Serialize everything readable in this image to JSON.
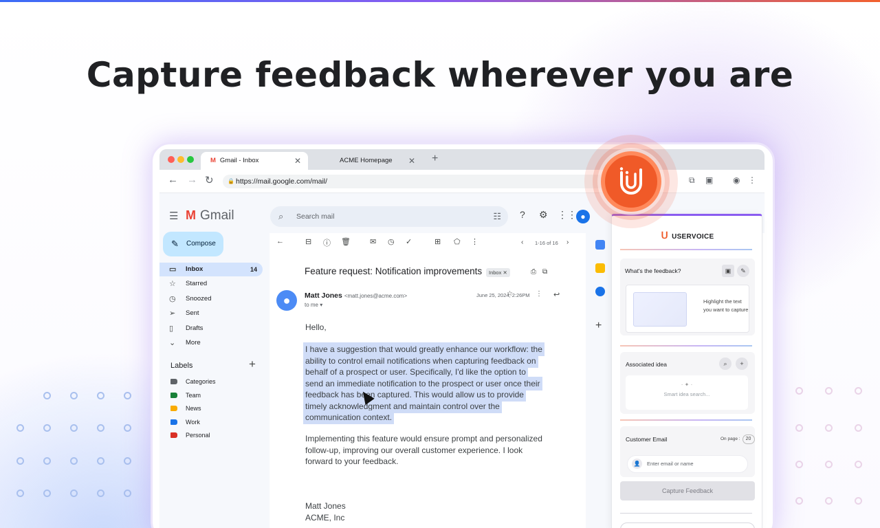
{
  "headline": "Capture feedback wherever you are",
  "browser": {
    "tabs": [
      {
        "label": "Gmail - Inbox",
        "icon": "gmail-icon",
        "active": true
      },
      {
        "label": "ACME Homepage",
        "icon": "none",
        "active": false
      }
    ],
    "new_tab": "+",
    "url": "https://mail.google.com/mail/"
  },
  "gmail": {
    "app_name": "Gmail",
    "search_placeholder": "Search mail",
    "compose_label": "Compose",
    "nav": [
      {
        "label": "Inbox",
        "count": "14",
        "icon": "inbox-icon"
      },
      {
        "label": "Starred",
        "count": "",
        "icon": "star-icon"
      },
      {
        "label": "Snoozed",
        "count": "",
        "icon": "clock-icon"
      },
      {
        "label": "Sent",
        "count": "",
        "icon": "send-icon"
      },
      {
        "label": "Drafts",
        "count": "",
        "icon": "draft-icon"
      },
      {
        "label": "More",
        "count": "",
        "icon": "chevron-down-icon"
      }
    ],
    "labels_header": "Labels",
    "labels": [
      {
        "label": "Categories",
        "color": "#5f6368"
      },
      {
        "label": "Team",
        "color": "#188038"
      },
      {
        "label": "News",
        "color": "#f9ab00"
      },
      {
        "label": "Work",
        "color": "#1a73e8"
      },
      {
        "label": "Personal",
        "color": "#d93025"
      }
    ],
    "pager": "1-16 of 16",
    "email": {
      "subject": "Feature request: Notification improvements",
      "tag": "Inbox",
      "sender_name": "Matt Jones",
      "sender_email": "<matt.jones@acme.com>",
      "to": "to me",
      "date": "June 25, 2024, 2:26PM",
      "greeting": "Hello,",
      "highlighted": [
        "I have a suggestion that would greatly enhance our workflow: the",
        "ability to control email notifications when capturing feedback on",
        "behalf of a prospect or user. Specifically, I'd like the option to",
        "send an immediate notification to the prospect or user once their",
        "feedback has been captured. This would allow us to provide",
        "timely acknowledgment and maintain control over the",
        "communication context."
      ],
      "paragraph2": [
        "Implementing this feature would ensure prompt and personalized",
        "follow-up, improving our overall customer experience. I look",
        "forward to your feedback."
      ],
      "signature_name": "Matt Jones",
      "signature_company": "ACME, Inc"
    }
  },
  "uservoice": {
    "brand": "USERVOICE",
    "feedback_title": "What's the feedback?",
    "capture_hint": "Highlight the text you want to capture",
    "associated_idea": "Associated idea",
    "smart_search_placeholder": "Smart idea search...",
    "customer_email": "Customer Email",
    "on_page_label": "On page :",
    "on_page_count": "20",
    "email_placeholder": "Enter email or name",
    "capture_button": "Capture Feedback",
    "accent": "#f05a28"
  }
}
